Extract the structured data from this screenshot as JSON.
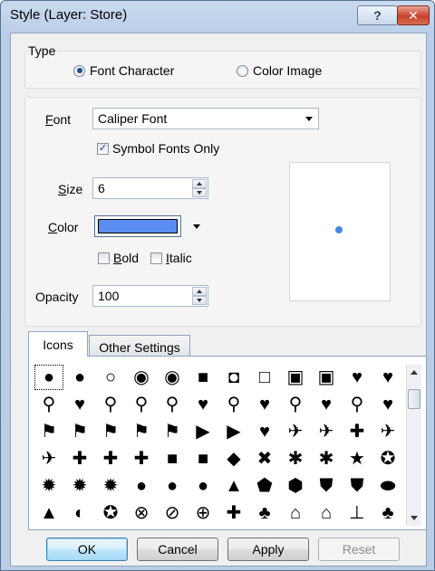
{
  "window": {
    "title": "Style (Layer: Store)",
    "help_label": "?",
    "close_label": "✕"
  },
  "type_group": {
    "label": "Type",
    "options": [
      {
        "label": "Font Character",
        "selected": true
      },
      {
        "label": "Color Image",
        "selected": false
      }
    ]
  },
  "font": {
    "label_prefix": "",
    "label_accel": "F",
    "label_rest": "ont",
    "value": "Caliper Font"
  },
  "symbol_fonts_only": {
    "label": "Symbol Fonts Only",
    "checked": true,
    "mark": "✓"
  },
  "size": {
    "label_accel": "S",
    "label_rest": "ize",
    "value": "6"
  },
  "color": {
    "label_accel": "C",
    "label_rest": "olor",
    "value": "#5b8ef0"
  },
  "bold": {
    "label_accel": "B",
    "label_rest": "old",
    "checked": false
  },
  "italic": {
    "label_accel": "I",
    "label_rest": "talic",
    "checked": false
  },
  "opacity": {
    "label": "Opacity",
    "value": "100"
  },
  "preview": {
    "symbol_color": "#4a86e8"
  },
  "tabs": [
    {
      "label": "Icons",
      "active": true
    },
    {
      "label": "Other Settings",
      "active": false
    }
  ],
  "icons": [
    "●",
    "●",
    "○",
    "◉",
    "◉",
    "■",
    "◘",
    "□",
    "▣",
    "▣",
    "♥",
    "♥",
    "⚲",
    "♥",
    "⚲",
    "⚲",
    "⚲",
    "♥",
    "⚲",
    "♥",
    "⚲",
    "♥",
    "⚲",
    "♥",
    "⚑",
    "⚑",
    "⚑",
    "⚑",
    "⚑",
    "▶",
    "▶",
    "♥",
    "✈",
    "✈",
    "✚",
    "✈",
    "✈",
    "✚",
    "✚",
    "✚",
    "■",
    "■",
    "◆",
    "✖",
    "✱",
    "✱",
    "★",
    "✪",
    "✹",
    "✹",
    "✹",
    "●",
    "●",
    "●",
    "▲",
    "⬟",
    "⬢",
    "⛊",
    "⛊",
    "⬬",
    "▲",
    "◐",
    "✪",
    "⊗",
    "⊘",
    "⊕",
    "✚",
    "♣",
    "⌂",
    "⌂",
    "⊥",
    "♣"
  ],
  "buttons": {
    "ok": "OK",
    "cancel": "Cancel",
    "apply": "Apply",
    "reset": "Reset"
  }
}
